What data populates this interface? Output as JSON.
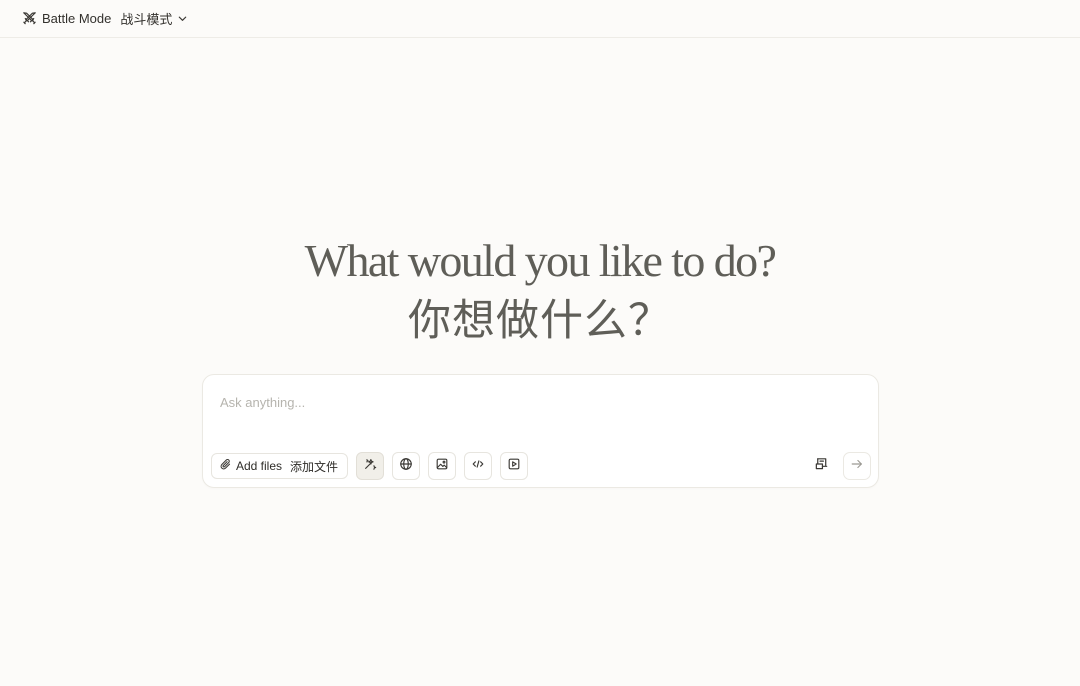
{
  "header": {
    "mode_label": "Battle Mode",
    "mode_label_cn": "战斗模式",
    "icon": "swords-icon",
    "dropdown_icon": "chevron-down-icon"
  },
  "hero": {
    "title_en": "What would you like to do?",
    "title_cn": "你想做什么？"
  },
  "composer": {
    "placeholder": "Ask anything...",
    "value": "",
    "add_files_label": "Add files",
    "add_files_label_cn": "添加文件",
    "tools": [
      {
        "name": "magic-wand-icon",
        "active": true
      },
      {
        "name": "globe-icon",
        "active": false
      },
      {
        "name": "image-icon",
        "active": false
      },
      {
        "name": "code-icon",
        "active": false
      },
      {
        "name": "video-play-icon",
        "active": false
      }
    ],
    "right_tools": [
      "prompt-library-icon",
      "send-arrow-icon"
    ]
  },
  "colors": {
    "background": "#fcfbf9",
    "heading": "#5f5e58",
    "border": "#ebe9e3",
    "placeholder": "#b6b4ae",
    "active_tool_bg": "#f1efe9"
  }
}
